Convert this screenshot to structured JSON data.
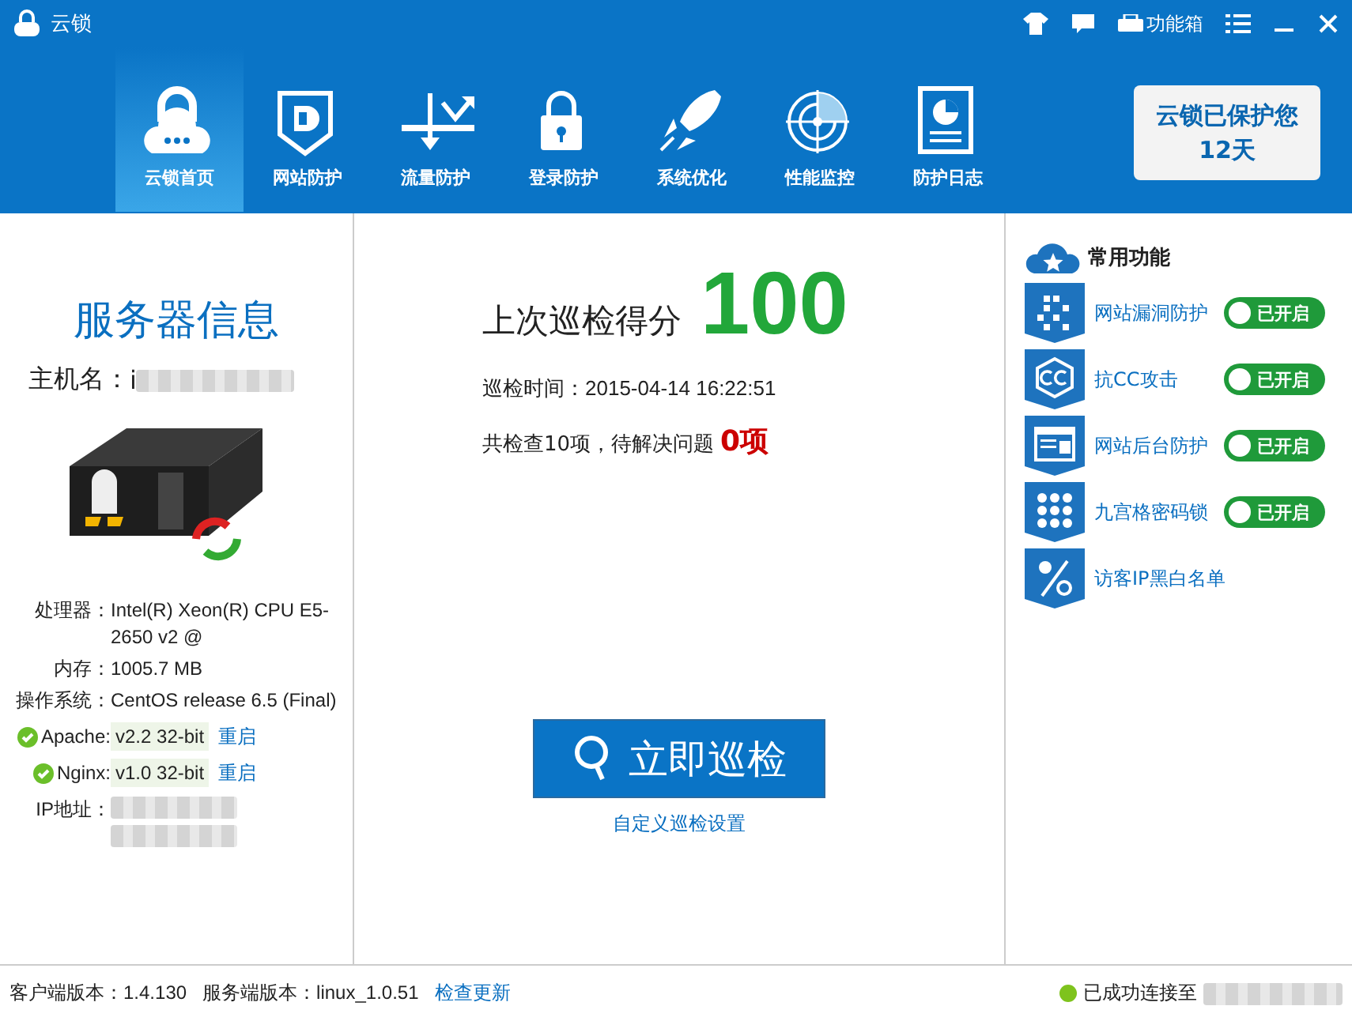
{
  "window": {
    "title": "云锁",
    "toolbox": "功能箱"
  },
  "nav": [
    {
      "label": "云锁首页",
      "selected": true
    },
    {
      "label": "网站防护",
      "selected": false
    },
    {
      "label": "流量防护",
      "selected": false
    },
    {
      "label": "登录防护",
      "selected": false
    },
    {
      "label": "系统优化",
      "selected": false
    },
    {
      "label": "性能监控",
      "selected": false
    },
    {
      "label": "防护日志",
      "selected": false
    }
  ],
  "protect_badge": {
    "line1": "云锁已保护您",
    "line2": "12天"
  },
  "server": {
    "title": "服务器信息",
    "hostname_label": "主机名：",
    "hostname": "i",
    "specs": [
      {
        "label": "处理器：",
        "value": "Intel(R) Xeon(R) CPU E5-2650 v2 @"
      },
      {
        "label": "内存：",
        "value": "1005.7 MB"
      },
      {
        "label": "操作系统：",
        "value": "CentOS release 6.5 (Final)"
      }
    ],
    "services": [
      {
        "label": "Apache:",
        "value": "v2.2 32-bit",
        "action": "重启",
        "ok": true
      },
      {
        "label": "Nginx:",
        "value": "v1.0 32-bit",
        "action": "重启",
        "ok": true
      }
    ],
    "ip_label": "IP地址："
  },
  "scan": {
    "score_label": "上次巡检得分",
    "score": "100",
    "time": "巡检时间：2015-04-14 16:22:51",
    "summary": "共检查10项，待解决问题",
    "issues": "0项",
    "button": "立即巡检",
    "settings_link": "自定义巡检设置"
  },
  "features": {
    "title": "常用功能",
    "items": [
      {
        "label": "网站漏洞防护",
        "kind": "toggle",
        "on": true,
        "state": "已开启"
      },
      {
        "label": "抗CC攻击",
        "kind": "toggle",
        "on": true,
        "state": "已开启"
      },
      {
        "label": "网站后台防护",
        "kind": "toggle",
        "on": true,
        "state": "已开启"
      },
      {
        "label": "九宫格密码锁",
        "kind": "toggle",
        "on": true,
        "state": "已开启"
      },
      {
        "label": "访客IP黑白名单",
        "kind": "link"
      }
    ]
  },
  "status_bar": {
    "client": "客户端版本：1.4.130",
    "server": "服务端版本：linux_1.0.51",
    "update": "检查更新",
    "connection": "已成功连接至"
  }
}
